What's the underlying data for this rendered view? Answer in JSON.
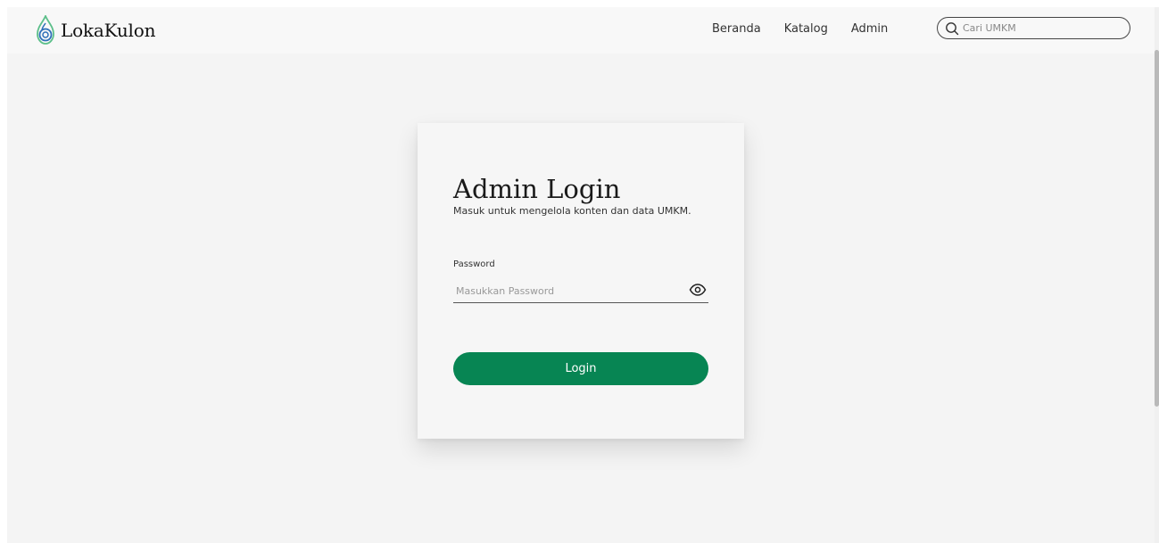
{
  "colors": {
    "page_background": "#f4f4f4",
    "navbar_background": "#f8f8f8",
    "card_background": "#f6f6f6",
    "accent_green": "#078553",
    "logo_blue": "#2d6fb8",
    "logo_green": "#5cbf8a"
  },
  "header": {
    "brand_name": "LokaKulon",
    "brand_icon": "lokakulon-logo-icon",
    "nav": [
      {
        "label": "Beranda"
      },
      {
        "label": "Katalog"
      },
      {
        "label": "Admin"
      }
    ],
    "search": {
      "icon": "search-icon",
      "placeholder": "Cari UMKM",
      "value": ""
    }
  },
  "login_card": {
    "title": "Admin Login",
    "subtitle": "Masuk untuk mengelola konten dan data UMKM.",
    "password": {
      "label": "Password",
      "placeholder": "Masukkan Password",
      "value": "",
      "toggle_icon": "eye-icon"
    },
    "submit_label": "Login"
  }
}
